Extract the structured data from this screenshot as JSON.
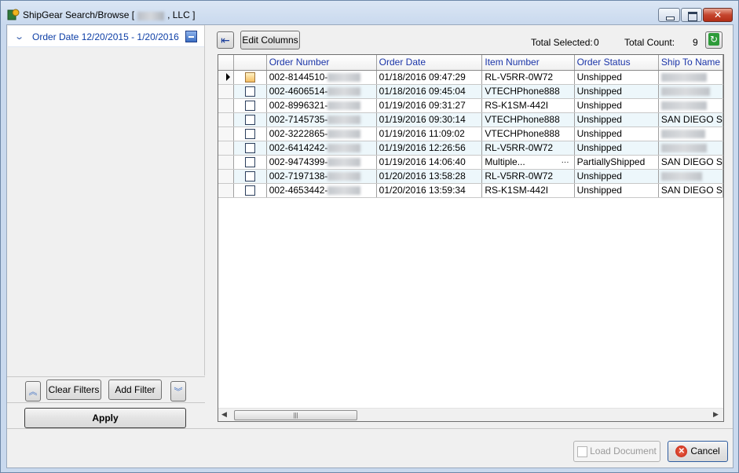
{
  "window": {
    "title_prefix": "ShipGear Search/Browse [",
    "title_suffix": ", LLC ]"
  },
  "filters": {
    "items": [
      {
        "label": "Order Date 12/20/2015 - 1/20/2016"
      }
    ],
    "clear_label": "Clear Filters",
    "add_label": "Add Filter",
    "apply_label": "Apply"
  },
  "toolbar": {
    "edit_columns_label": "Edit Columns",
    "total_selected_label": "Total Selected:",
    "total_selected_value": "0",
    "total_count_label": "Total Count:",
    "total_count_value": "9"
  },
  "grid": {
    "columns": [
      "Order Number",
      "Order Date",
      "Item Number",
      "Order Status",
      "Ship To Name"
    ],
    "rows": [
      {
        "order_number": "002-8144510-",
        "order_date": "01/18/2016 09:47:29",
        "item_number": "RL-V5RR-0W72",
        "status": "Unshipped",
        "ship_to": ""
      },
      {
        "order_number": "002-4606514-",
        "order_date": "01/18/2016 09:45:04",
        "item_number": "VTECHPhone888",
        "status": "Unshipped",
        "ship_to": ""
      },
      {
        "order_number": "002-8996321-",
        "order_date": "01/19/2016 09:31:27",
        "item_number": "RS-K1SM-442I",
        "status": "Unshipped",
        "ship_to": ""
      },
      {
        "order_number": "002-7145735-",
        "order_date": "01/19/2016 09:30:14",
        "item_number": "VTECHPhone888",
        "status": "Unshipped",
        "ship_to": "SAN DIEGO S"
      },
      {
        "order_number": "002-3222865-",
        "order_date": "01/19/2016 11:09:02",
        "item_number": "VTECHPhone888",
        "status": "Unshipped",
        "ship_to": ""
      },
      {
        "order_number": "002-6414242-",
        "order_date": "01/19/2016 12:26:56",
        "item_number": "RL-V5RR-0W72",
        "status": "Unshipped",
        "ship_to": ""
      },
      {
        "order_number": "002-9474399-",
        "order_date": "01/19/2016 14:06:40",
        "item_number": "Multiple...",
        "status": "PartiallyShipped",
        "ship_to": "SAN DIEGO S"
      },
      {
        "order_number": "002-7197138-",
        "order_date": "01/20/2016 13:58:28",
        "item_number": "RL-V5RR-0W72",
        "status": "Unshipped",
        "ship_to": ""
      },
      {
        "order_number": "002-4653442-",
        "order_date": "01/20/2016 13:59:34",
        "item_number": "RS-K1SM-442I",
        "status": "Unshipped",
        "ship_to": "SAN DIEGO S"
      }
    ],
    "multi_item_ellipsis": "···"
  },
  "footer": {
    "load_label": "Load Document",
    "cancel_label": "Cancel"
  },
  "colors": {
    "header_text": "#1a34a8",
    "alt_row": "#edf7fb",
    "filter_text": "#0d3ea6"
  }
}
